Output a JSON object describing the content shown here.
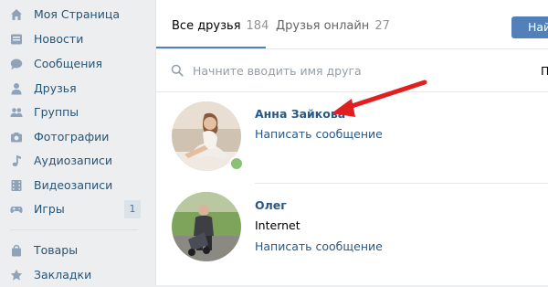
{
  "sidebar": {
    "items": [
      {
        "label": "Моя Страница",
        "icon": "home-icon"
      },
      {
        "label": "Новости",
        "icon": "news-icon"
      },
      {
        "label": "Сообщения",
        "icon": "messages-icon"
      },
      {
        "label": "Друзья",
        "icon": "person-icon"
      },
      {
        "label": "Группы",
        "icon": "groups-icon"
      },
      {
        "label": "Фотографии",
        "icon": "camera-icon"
      },
      {
        "label": "Аудиозаписи",
        "icon": "music-note-icon"
      },
      {
        "label": "Видеозаписи",
        "icon": "film-icon"
      },
      {
        "label": "Игры",
        "icon": "gamepad-icon",
        "badge": "1"
      },
      {
        "label": "Товары",
        "icon": "shopping-bag-icon"
      },
      {
        "label": "Закладки",
        "icon": "star-icon"
      }
    ]
  },
  "tabs": {
    "all": {
      "label": "Все друзья",
      "count": "184"
    },
    "online": {
      "label": "Друзья онлайн",
      "count": "27"
    }
  },
  "find_button": {
    "label": "Най"
  },
  "search": {
    "placeholder": "Начните вводить имя друга",
    "params_label": "П"
  },
  "friends": [
    {
      "name": "Анна Зайкова",
      "subtitle": "",
      "action": "Написать сообщение",
      "online": true
    },
    {
      "name": "Олег",
      "subtitle": "Internet",
      "action": "Написать сообщение",
      "online": false
    }
  ],
  "colors": {
    "accent": "#5181b8",
    "link": "#2a5885",
    "online": "#8ac176",
    "arrow": "#e02020",
    "sidebar_bg": "#edeef0"
  }
}
